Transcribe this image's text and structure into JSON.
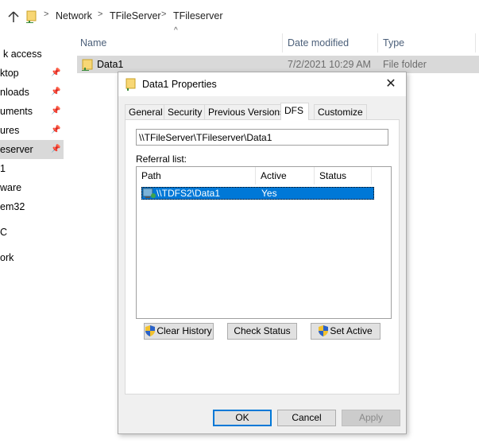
{
  "breadcrumb": {
    "items": [
      "Network",
      "TFileServer",
      "TFileserver"
    ],
    "separator": ">"
  },
  "nav": {
    "items": [
      {
        "label": "k access",
        "pinned": false,
        "selected": false
      },
      {
        "label": "ktop",
        "pinned": true,
        "selected": false
      },
      {
        "label": "nloads",
        "pinned": true,
        "selected": false
      },
      {
        "label": "uments",
        "pinned": true,
        "selected": false
      },
      {
        "label": "ures",
        "pinned": true,
        "selected": false
      },
      {
        "label": "eserver",
        "pinned": true,
        "selected": true
      },
      {
        "label": "1",
        "pinned": false,
        "selected": false
      },
      {
        "label": "ware",
        "pinned": false,
        "selected": false
      },
      {
        "label": "em32",
        "pinned": false,
        "selected": false
      },
      {
        "label": "C",
        "pinned": false,
        "selected": false
      },
      {
        "label": "ork",
        "pinned": false,
        "selected": false
      }
    ]
  },
  "file_list": {
    "columns": {
      "name": "Name",
      "date": "Date modified",
      "type": "Type"
    },
    "rows": [
      {
        "name": "Data1",
        "date": "7/2/2021 10:29 AM",
        "type": "File folder"
      }
    ]
  },
  "dialog": {
    "title": "Data1 Properties",
    "close_label": "✕",
    "tabs": [
      {
        "label": "General",
        "active": false
      },
      {
        "label": "Security",
        "active": false
      },
      {
        "label": "Previous Versions",
        "active": false
      },
      {
        "label": "DFS",
        "active": true
      },
      {
        "label": "Customize",
        "active": false
      }
    ],
    "dfs": {
      "path_value": "\\\\TFileServer\\TFileserver\\Data1",
      "referral_label": "Referral list:",
      "columns": {
        "path": "Path",
        "active": "Active",
        "status": "Status"
      },
      "referrals": [
        {
          "path": "\\\\TDFS2\\Data1",
          "active": "Yes",
          "status": ""
        }
      ],
      "buttons": {
        "clear_history": "Clear History",
        "check_status": "Check Status",
        "set_active": "Set Active"
      }
    },
    "footer": {
      "ok": "OK",
      "cancel": "Cancel",
      "apply": "Apply"
    }
  },
  "colors": {
    "selection": "#0078d7",
    "folder": "#f8d775",
    "header_text": "#4c607a"
  }
}
